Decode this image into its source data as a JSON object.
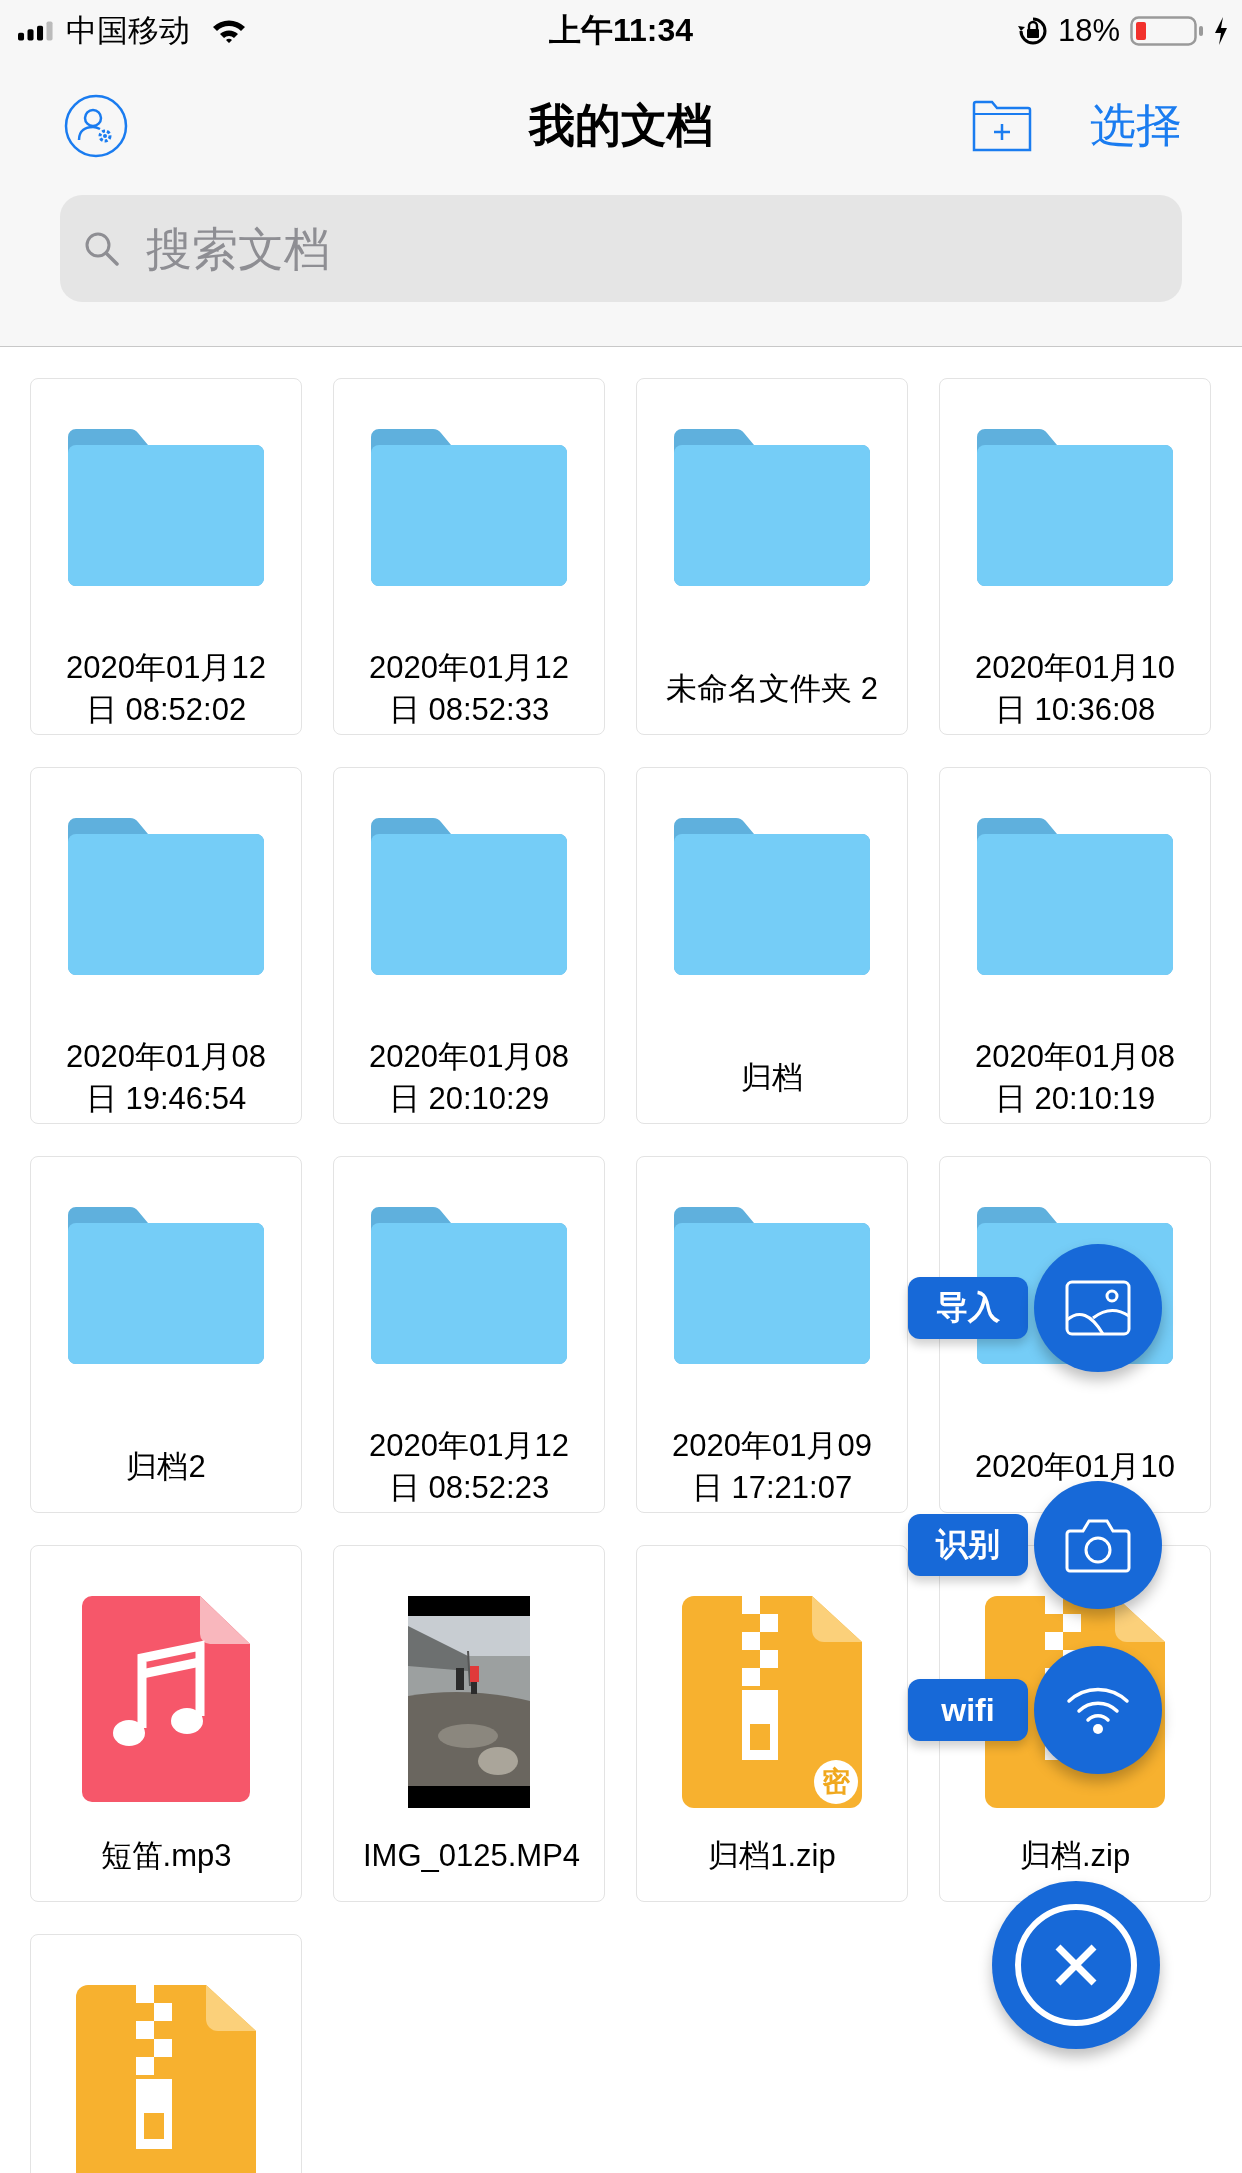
{
  "status_bar": {
    "carrier": "中国移动",
    "time": "上午11:34",
    "battery": "18%"
  },
  "header": {
    "title": "我的文档",
    "select_button": "选择"
  },
  "search": {
    "placeholder": "搜索文档"
  },
  "items": [
    {
      "kind": "folder",
      "name": "2020年01月12日 08:52:02"
    },
    {
      "kind": "folder",
      "name": "2020年01月12日 08:52:33"
    },
    {
      "kind": "folder",
      "name": "未命名文件夹 2"
    },
    {
      "kind": "folder",
      "name": "2020年01月10日 10:36:08"
    },
    {
      "kind": "folder",
      "name": "2020年01月08日 19:46:54"
    },
    {
      "kind": "folder",
      "name": "2020年01月08日 20:10:29"
    },
    {
      "kind": "folder",
      "name": "归档"
    },
    {
      "kind": "folder",
      "name": "2020年01月08日 20:10:19"
    },
    {
      "kind": "folder",
      "name": "归档2"
    },
    {
      "kind": "folder",
      "name": "2020年01月12日 08:52:23"
    },
    {
      "kind": "folder",
      "name": "2020年01月09日 17:21:07"
    },
    {
      "kind": "folder",
      "name": "2020年01月10"
    },
    {
      "kind": "audio",
      "name": "短笛.mp3"
    },
    {
      "kind": "video",
      "name": "IMG_0125.MP4"
    },
    {
      "kind": "archive",
      "name": "归档1.zip",
      "badge": "密"
    },
    {
      "kind": "archive",
      "name": "归档.zip"
    },
    {
      "kind": "archive"
    }
  ],
  "actions": [
    {
      "kind": "import",
      "label": "导入"
    },
    {
      "kind": "scan",
      "label": "识别"
    },
    {
      "kind": "wifi",
      "label": "wifi"
    }
  ]
}
